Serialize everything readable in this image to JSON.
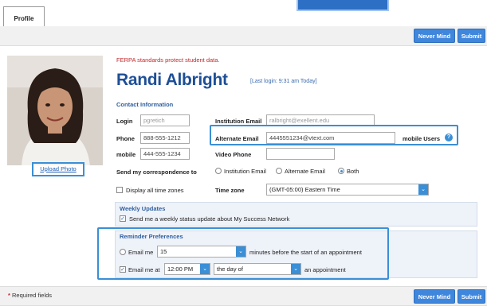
{
  "tabs": {
    "profile": "Profile"
  },
  "actions": {
    "never_mind": "Never Mind",
    "submit": "Submit"
  },
  "photo": {
    "upload_label": "Upload Photo"
  },
  "header": {
    "ferpa_note": "FERPA standards protect student data.",
    "name": "Randi Albright",
    "last_login": "[Last login: 9:31 am Today]"
  },
  "contact": {
    "title": "Contact Information",
    "login_label": "Login",
    "login_value": "pgretich",
    "institution_email_label": "Institution Email",
    "institution_email_value": "ralbright@exellent.edu",
    "phone_label": "Phone",
    "phone_value": "888-555-1212",
    "alternate_email_label": "Alternate Email",
    "alternate_email_value": "4445551234@vtext.com",
    "mobile_users_label": "mobile Users",
    "mobile_label": "mobile",
    "mobile_value": "444-555-1234",
    "video_phone_label": "Video Phone",
    "video_phone_value": ""
  },
  "correspondence": {
    "label": "Send my correspondence to",
    "options": [
      "Institution Email",
      "Alternate Email",
      "Both"
    ],
    "selected": "Both"
  },
  "timezone": {
    "display_all_label": "Display all time zones",
    "display_all_checked": false,
    "label": "Time zone",
    "value": "(GMT-05:00) Eastern Time"
  },
  "weekly": {
    "title": "Weekly Updates",
    "checkbox_label": "Send me a weekly status update about My Success Network",
    "checked": true
  },
  "reminders": {
    "title": "Reminder Preferences",
    "row1": {
      "label": "Email me",
      "minutes": "15",
      "suffix": "minutes before the start of an appointment",
      "checked": false
    },
    "row2": {
      "label": "Email me at",
      "time": "12:00 PM",
      "when": "the day of",
      "suffix": "an appointment",
      "checked": true
    }
  },
  "footer": {
    "required_note": "Required fields",
    "required_mark": "*"
  },
  "icons": {
    "help": "question-circle-icon",
    "dropdown": "chevron-down-icon",
    "check": "checkmark-icon"
  },
  "colors": {
    "accent": "#3a8fd6",
    "name": "#1e4f96",
    "ferpa": "#c3272a",
    "button": "#3f86dd"
  }
}
